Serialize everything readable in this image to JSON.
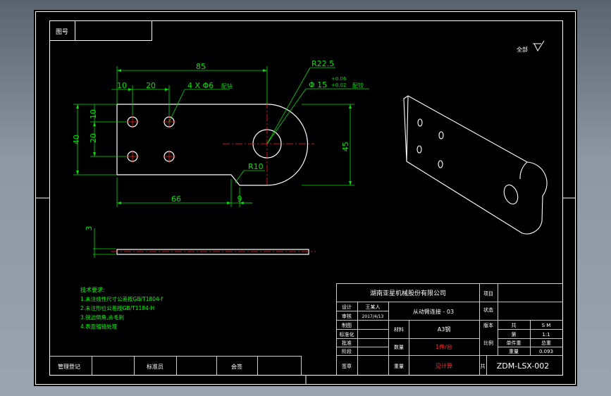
{
  "corner_label": "图号",
  "roughness_label": "全部",
  "dimensions": {
    "d85": "85",
    "d10": "10",
    "d20_top": "20",
    "holes": "4 X Φ6",
    "holes_note": "配钻",
    "r22": "R22.5",
    "hole15": "Φ 15",
    "tol_upper": "+0.06",
    "tol_lower": "+0.02",
    "hole15_note": "配铰",
    "v10": "10",
    "v20": "20",
    "v40": "40",
    "v45": "45",
    "r10": "R10",
    "d66": "66",
    "d9": "9",
    "thk": "3"
  },
  "tech_requirements": {
    "title": "技术要求:",
    "items": [
      "1.未注线性尺寸公差按GB/T1804-f",
      "2.未注形位公差按GB/T1184-H",
      "3.锐边倒角,去毛刺",
      "4.表面镀铬处理"
    ]
  },
  "title_block": {
    "company": "湖南亚星机械股份有限公司",
    "label_proj": "项目",
    "label_designer": "设计",
    "designer_name": "王某人",
    "label_review": "审核",
    "date": "2017/4/13",
    "label_draw": "制图",
    "label_std": "标准化",
    "label_approve": "批准",
    "part_name": "从动臂连接 - 03",
    "label_material": "材料",
    "material": "A3钢",
    "label_count": "数量",
    "count": "1件/台",
    "label_weight": "重量",
    "weight_val": "见计算",
    "label_ver": "版本",
    "label_status": "状态",
    "label_scale": "比例",
    "scale": "1:1",
    "label_unit_w": "单件重",
    "label_total": "总重",
    "weight_kg": "0.093",
    "label_a": "阶段",
    "stage": "S  M",
    "label_b": "共",
    "label_c": "第",
    "label_seal": "签章",
    "drawing_no": "ZDM-LSX-002"
  },
  "footer": {
    "c1": "管理登记",
    "c2": "标准员",
    "c3": "会签"
  },
  "colors": {
    "line": "#ffffff",
    "dim": "#00e000",
    "center": "#ff2020",
    "note": "#00ff00"
  }
}
